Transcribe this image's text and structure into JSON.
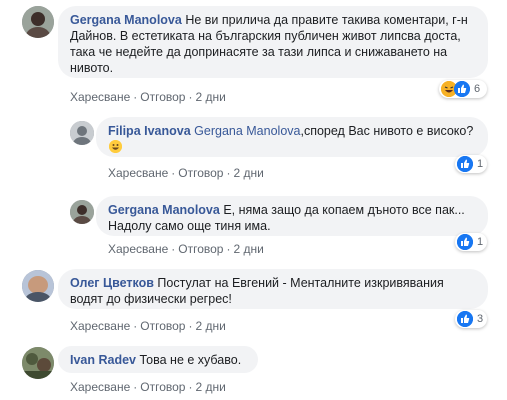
{
  "comments": [
    {
      "author": "Gergana Manolova",
      "text": "Не ви прилича да правите такива коментари, г-н Дайнов. В естетиката на българския публичен живот липсва доста, така че недейте да допринасяте за тази липса и снижаването на нивото.",
      "like": "Харесване",
      "reply": "Отговор",
      "time": "2 дни",
      "reaction_count": "6",
      "reaction_icons": [
        "haha-icon",
        "like-icon"
      ]
    },
    {
      "author": "Filipa Ivanova",
      "mention": "Gergana Manolova",
      "text": ",според Вас нивото е високо?",
      "emoji": "grinning-face-icon",
      "like": "Харесване",
      "reply": "Отговор",
      "time": "2 дни",
      "reaction_count": "1",
      "reaction_icons": [
        "like-icon"
      ]
    },
    {
      "author": "Gergana Manolova",
      "text": "Е, няма защо да копаем дъното все пак... Надолу само още тиня има.",
      "like": "Харесване",
      "reply": "Отговор",
      "time": "2 дни",
      "reaction_count": "1",
      "reaction_icons": [
        "like-icon"
      ]
    },
    {
      "author": "Олег Цветков",
      "text": "Постулат на Евгений - Менталните изкривявания водят до физически регрес!",
      "like": "Харесване",
      "reply": "Отговор",
      "time": "2 дни",
      "reaction_count": "3",
      "reaction_icons": [
        "like-icon"
      ]
    },
    {
      "author": "Ivan Radev",
      "text": "Това не е хубаво.",
      "like": "Харесване",
      "reply": "Отговор",
      "time": "2 дни"
    }
  ],
  "separator": "·",
  "colors": {
    "author": "#385898",
    "bubble": "#f2f3f5",
    "meta": "#606770",
    "like": "#1877f2"
  }
}
